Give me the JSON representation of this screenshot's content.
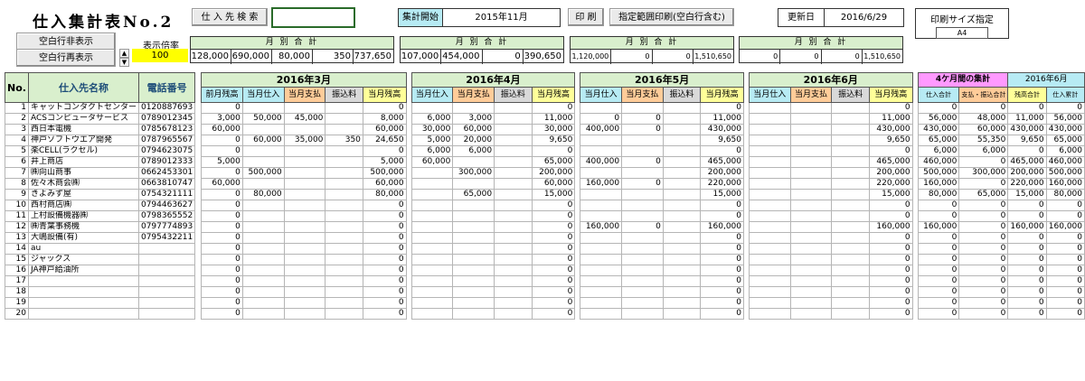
{
  "title": "仕入集計表No.2",
  "buttons": {
    "hide_blank": "空白行非表示",
    "show_blank": "空白行再表示",
    "supplier_search": "仕 入 先 検 索",
    "print": "印 刷",
    "print_range": "指定範囲印刷(空白行含む)"
  },
  "zoom": {
    "label": "表示倍率",
    "value": "100"
  },
  "search_value": "",
  "period": {
    "label": "集計開始",
    "value": "2015年11月"
  },
  "updated": {
    "label": "更新日",
    "value": "2016/6/29"
  },
  "print_size": {
    "label": "印刷サイズ指定",
    "value": "A4"
  },
  "monthly_totals": [
    {
      "label": "月 別 合 計",
      "values": [
        "128,000",
        "690,000",
        "80,000",
        "350",
        "737,650"
      ]
    },
    {
      "label": "月 別 合 計",
      "values": [
        "107,000",
        "454,000",
        "0",
        "390,650"
      ]
    },
    {
      "label": "月 別 合 計",
      "values": [
        "1,120,000",
        "0",
        "0",
        "1,510,650"
      ]
    },
    {
      "label": "月 別 合 計",
      "values": [
        "0",
        "0",
        "0",
        "1,510,650"
      ]
    }
  ],
  "headers": {
    "no": "No.",
    "name": "仕入先名称",
    "tel": "電話番号",
    "months": [
      "2016年3月",
      "2016年4月",
      "2016年5月",
      "2016年6月"
    ],
    "summary": "4ケ月間の集計",
    "summary_month": "2016年6月",
    "mar_cols": [
      "前月残高",
      "当月仕入",
      "当月支払",
      "振込料",
      "当月残高"
    ],
    "other_cols": [
      "当月仕入",
      "当月支払",
      "振込料",
      "当月残高"
    ],
    "sum_cols": [
      "仕入合計",
      "支払・振込合計",
      "残高合計",
      "仕入累計"
    ]
  },
  "rows": [
    {
      "no": "1",
      "name": "キャットコンタクトセンター",
      "tel": "0120887693",
      "mar": [
        "0",
        "",
        "",
        "",
        "0"
      ],
      "apr": [
        "",
        "",
        "",
        "0"
      ],
      "may": [
        "",
        "",
        "",
        "0"
      ],
      "jun": [
        "",
        "",
        "",
        "0"
      ],
      "sum": [
        "0",
        "0",
        "0",
        "0"
      ]
    },
    {
      "no": "2",
      "name": "ACSコンピュータサービス",
      "tel": "0789012345",
      "mar": [
        "3,000",
        "50,000",
        "45,000",
        "",
        "8,000"
      ],
      "apr": [
        "6,000",
        "3,000",
        "",
        "11,000"
      ],
      "may": [
        "0",
        "0",
        "",
        "11,000"
      ],
      "jun": [
        "",
        "",
        "",
        "11,000"
      ],
      "sum": [
        "56,000",
        "48,000",
        "11,000",
        "56,000"
      ]
    },
    {
      "no": "3",
      "name": "西日本電機",
      "tel": "0785678123",
      "mar": [
        "60,000",
        "",
        "",
        "",
        "60,000"
      ],
      "apr": [
        "30,000",
        "60,000",
        "",
        "30,000"
      ],
      "may": [
        "400,000",
        "0",
        "",
        "430,000"
      ],
      "jun": [
        "",
        "",
        "",
        "430,000"
      ],
      "sum": [
        "430,000",
        "60,000",
        "430,000",
        "430,000"
      ]
    },
    {
      "no": "4",
      "name": "神戸ソフトウエア開発",
      "tel": "0787965567",
      "mar": [
        "0",
        "60,000",
        "35,000",
        "350",
        "24,650"
      ],
      "apr": [
        "5,000",
        "20,000",
        "",
        "9,650"
      ],
      "may": [
        "",
        "",
        "",
        "9,650"
      ],
      "jun": [
        "",
        "",
        "",
        "9,650"
      ],
      "sum": [
        "65,000",
        "55,350",
        "9,650",
        "65,000"
      ]
    },
    {
      "no": "5",
      "name": "楽CELL(ラクセル)",
      "tel": "0794623075",
      "mar": [
        "0",
        "",
        "",
        "",
        "0"
      ],
      "apr": [
        "6,000",
        "6,000",
        "",
        "0"
      ],
      "may": [
        "",
        "",
        "",
        "0"
      ],
      "jun": [
        "",
        "",
        "",
        "0"
      ],
      "sum": [
        "6,000",
        "6,000",
        "0",
        "6,000"
      ]
    },
    {
      "no": "6",
      "name": "井上商店",
      "tel": "0789012333",
      "mar": [
        "5,000",
        "",
        "",
        "",
        "5,000"
      ],
      "apr": [
        "60,000",
        "",
        "",
        "65,000"
      ],
      "may": [
        "400,000",
        "0",
        "",
        "465,000"
      ],
      "jun": [
        "",
        "",
        "",
        "465,000"
      ],
      "sum": [
        "460,000",
        "0",
        "465,000",
        "460,000"
      ]
    },
    {
      "no": "7",
      "name": "㈱向山商事",
      "tel": "0662453301",
      "mar": [
        "0",
        "500,000",
        "",
        "",
        "500,000"
      ],
      "apr": [
        "",
        "300,000",
        "",
        "200,000"
      ],
      "may": [
        "",
        "",
        "",
        "200,000"
      ],
      "jun": [
        "",
        "",
        "",
        "200,000"
      ],
      "sum": [
        "500,000",
        "300,000",
        "200,000",
        "500,000"
      ]
    },
    {
      "no": "8",
      "name": "佐々木商会㈱",
      "tel": "0663810747",
      "mar": [
        "60,000",
        "",
        "",
        "",
        "60,000"
      ],
      "apr": [
        "",
        "",
        "",
        "60,000"
      ],
      "may": [
        "160,000",
        "0",
        "",
        "220,000"
      ],
      "jun": [
        "",
        "",
        "",
        "220,000"
      ],
      "sum": [
        "160,000",
        "0",
        "220,000",
        "160,000"
      ]
    },
    {
      "no": "9",
      "name": "きよみず屋",
      "tel": "0754321111",
      "mar": [
        "0",
        "80,000",
        "",
        "",
        "80,000"
      ],
      "apr": [
        "",
        "65,000",
        "",
        "15,000"
      ],
      "may": [
        "",
        "",
        "",
        "15,000"
      ],
      "jun": [
        "",
        "",
        "",
        "15,000"
      ],
      "sum": [
        "80,000",
        "65,000",
        "15,000",
        "80,000"
      ]
    },
    {
      "no": "10",
      "name": "西村商店㈱",
      "tel": "0794463627",
      "mar": [
        "0",
        "",
        "",
        "",
        "0"
      ],
      "apr": [
        "",
        "",
        "",
        "0"
      ],
      "may": [
        "",
        "",
        "",
        "0"
      ],
      "jun": [
        "",
        "",
        "",
        "0"
      ],
      "sum": [
        "0",
        "0",
        "0",
        "0"
      ]
    },
    {
      "no": "11",
      "name": "上村設備機器㈱",
      "tel": "0798365552",
      "mar": [
        "0",
        "",
        "",
        "",
        "0"
      ],
      "apr": [
        "",
        "",
        "",
        "0"
      ],
      "may": [
        "",
        "",
        "",
        "0"
      ],
      "jun": [
        "",
        "",
        "",
        "0"
      ],
      "sum": [
        "0",
        "0",
        "0",
        "0"
      ]
    },
    {
      "no": "12",
      "name": "㈱青葉事務機",
      "tel": "0797774893",
      "mar": [
        "0",
        "",
        "",
        "",
        "0"
      ],
      "apr": [
        "",
        "",
        "",
        "0"
      ],
      "may": [
        "160,000",
        "0",
        "",
        "160,000"
      ],
      "jun": [
        "",
        "",
        "",
        "160,000"
      ],
      "sum": [
        "160,000",
        "0",
        "160,000",
        "160,000"
      ]
    },
    {
      "no": "13",
      "name": "大嶋設備(有)",
      "tel": "0795432211",
      "mar": [
        "0",
        "",
        "",
        "",
        "0"
      ],
      "apr": [
        "",
        "",
        "",
        "0"
      ],
      "may": [
        "",
        "",
        "",
        "0"
      ],
      "jun": [
        "",
        "",
        "",
        "0"
      ],
      "sum": [
        "0",
        "0",
        "0",
        "0"
      ]
    },
    {
      "no": "14",
      "name": "au",
      "tel": "",
      "mar": [
        "0",
        "",
        "",
        "",
        "0"
      ],
      "apr": [
        "",
        "",
        "",
        "0"
      ],
      "may": [
        "",
        "",
        "",
        "0"
      ],
      "jun": [
        "",
        "",
        "",
        "0"
      ],
      "sum": [
        "0",
        "0",
        "0",
        "0"
      ]
    },
    {
      "no": "15",
      "name": "ジャックス",
      "tel": "",
      "mar": [
        "0",
        "",
        "",
        "",
        "0"
      ],
      "apr": [
        "",
        "",
        "",
        "0"
      ],
      "may": [
        "",
        "",
        "",
        "0"
      ],
      "jun": [
        "",
        "",
        "",
        "0"
      ],
      "sum": [
        "0",
        "0",
        "0",
        "0"
      ]
    },
    {
      "no": "16",
      "name": "JA神戸給油所",
      "tel": "",
      "mar": [
        "0",
        "",
        "",
        "",
        "0"
      ],
      "apr": [
        "",
        "",
        "",
        "0"
      ],
      "may": [
        "",
        "",
        "",
        "0"
      ],
      "jun": [
        "",
        "",
        "",
        "0"
      ],
      "sum": [
        "0",
        "0",
        "0",
        "0"
      ]
    },
    {
      "no": "17",
      "name": "",
      "tel": "",
      "mar": [
        "0",
        "",
        "",
        "",
        "0"
      ],
      "apr": [
        "",
        "",
        "",
        "0"
      ],
      "may": [
        "",
        "",
        "",
        "0"
      ],
      "jun": [
        "",
        "",
        "",
        "0"
      ],
      "sum": [
        "0",
        "0",
        "0",
        "0"
      ]
    },
    {
      "no": "18",
      "name": "",
      "tel": "",
      "mar": [
        "0",
        "",
        "",
        "",
        "0"
      ],
      "apr": [
        "",
        "",
        "",
        "0"
      ],
      "may": [
        "",
        "",
        "",
        "0"
      ],
      "jun": [
        "",
        "",
        "",
        "0"
      ],
      "sum": [
        "0",
        "0",
        "0",
        "0"
      ]
    },
    {
      "no": "19",
      "name": "",
      "tel": "",
      "mar": [
        "0",
        "",
        "",
        "",
        "0"
      ],
      "apr": [
        "",
        "",
        "",
        "0"
      ],
      "may": [
        "",
        "",
        "",
        "0"
      ],
      "jun": [
        "",
        "",
        "",
        "0"
      ],
      "sum": [
        "0",
        "0",
        "0",
        "0"
      ]
    },
    {
      "no": "20",
      "name": "",
      "tel": "",
      "mar": [
        "0",
        "",
        "",
        "",
        "0"
      ],
      "apr": [
        "",
        "",
        "",
        "0"
      ],
      "may": [
        "",
        "",
        "",
        "0"
      ],
      "jun": [
        "",
        "",
        "",
        "0"
      ],
      "sum": [
        "0",
        "0",
        "0",
        "0"
      ]
    }
  ]
}
